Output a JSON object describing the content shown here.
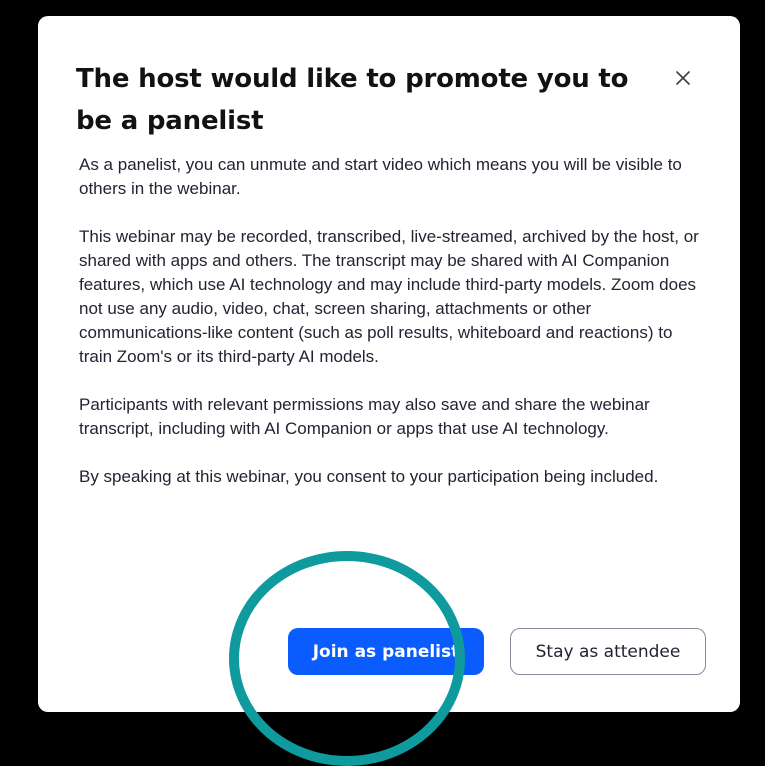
{
  "dialog": {
    "title": "The host would like to promote you to be a panelist",
    "close_icon": "close-icon",
    "paragraphs": [
      "As a panelist, you can unmute and start video which means you will be visible to others in the webinar.",
      "This webinar may be recorded, transcribed, live-streamed, archived by the host, or shared with apps and others. The transcript may be shared with AI Companion features, which use AI technology and may include third-party models. Zoom does not use any audio, video, chat, screen sharing, attachments or other communications-like content (such as poll results, whiteboard and reactions) to train Zoom's or its third-party AI models.",
      "Participants with relevant permissions may also save and share the webinar transcript, including with AI Companion or apps that use AI technology.",
      "By speaking at this webinar, you consent to your participation being included."
    ],
    "primary_button": "Join as panelist",
    "secondary_button": "Stay as attendee"
  },
  "colors": {
    "background": "#000000",
    "dialog_bg": "#ffffff",
    "primary": "#0b5cff",
    "highlight_ring": "#0f9a9e",
    "text": "#232333"
  }
}
